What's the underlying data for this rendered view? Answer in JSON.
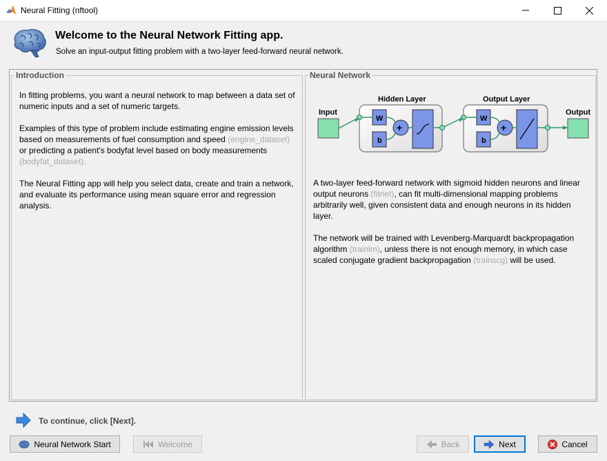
{
  "window": {
    "title": "Neural Fitting (nftool)",
    "controls": [
      "minimize",
      "maximize",
      "close"
    ]
  },
  "header": {
    "title": "Welcome to the Neural Network Fitting app.",
    "subtitle": "Solve an input-output fitting problem with a two-layer feed-forward neural network."
  },
  "intro": {
    "legend": "Introduction",
    "p1": "In fitting problems, you want a neural network to map between a data set of numeric inputs and a set of numeric targets.",
    "p2_a": "Examples of this type of problem include estimating engine emission levels based on measurements of fuel consumption and speed",
    "p2_b": "(engine_dataset)",
    "p2_c": "or predicting a patient's bodyfat level based on body measurements",
    "p2_d": "(bodyfat_dataset).",
    "p3": "The Neural Fitting app will help you select data, create and train a network, and evaluate its performance using mean square error and regression analysis."
  },
  "network": {
    "legend": "Neural Network",
    "diagram": {
      "input_label": "Input",
      "hidden_label": "Hidden Layer",
      "output_layer_label": "Output Layer",
      "output_label": "Output",
      "w": "W",
      "b": "b",
      "plus": "+"
    },
    "p1_a": "A two-layer feed-forward network with sigmoid hidden neurons and linear output neurons",
    "p1_b": "(fitnet)",
    "p1_c": ", can fit multi-dimensional mapping problems arbitrarily well, given consistent data and enough neurons in its hidden layer.",
    "p2_a": "The network will be trained with Levenberg-Marquardt backpropagation algorithm",
    "p2_b": "(trainlm)",
    "p2_c": ", unless there is not enough memory, in which case scaled conjugate gradient backpropagation",
    "p2_d": "(trainscg)",
    "p2_e": "will be used."
  },
  "footer": {
    "hint": "To continue, click [Next].",
    "buttons": {
      "start": "Neural Network Start",
      "welcome": "Welcome",
      "back": "Back",
      "next": "Next",
      "cancel": "Cancel"
    }
  },
  "colors": {
    "accent_blue": "#0078d7",
    "neuron_blue": "#7b95e8",
    "io_green": "#86e0b0",
    "link_green": "#2e9a6a",
    "muted_text": "#a8a8a8"
  }
}
